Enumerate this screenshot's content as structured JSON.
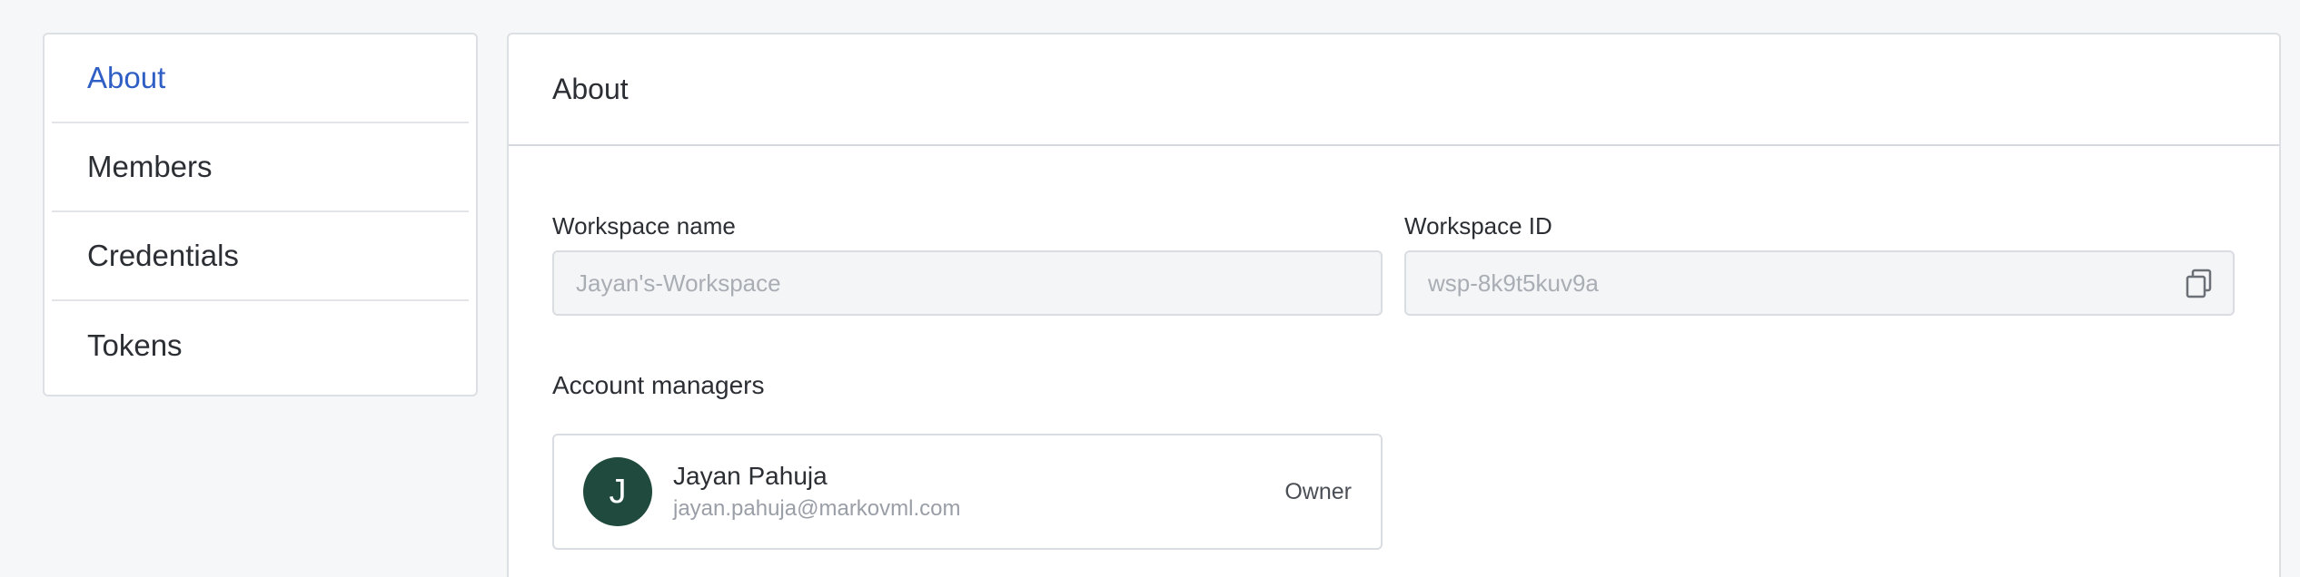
{
  "sidebar": {
    "items": [
      {
        "label": "About",
        "active": true
      },
      {
        "label": "Members",
        "active": false
      },
      {
        "label": "Credentials",
        "active": false
      },
      {
        "label": "Tokens",
        "active": false
      }
    ]
  },
  "main": {
    "title": "About",
    "workspace_name": {
      "label": "Workspace name",
      "value": "Jayan's-Workspace"
    },
    "workspace_id": {
      "label": "Workspace ID",
      "value": "wsp-8k9t5kuv9a",
      "copy_icon": "copy-icon"
    },
    "account_managers": {
      "label": "Account managers",
      "items": [
        {
          "initial": "J",
          "name": "Jayan Pahuja",
          "email": "jayan.pahuja@markovml.com",
          "role": "Owner"
        }
      ]
    }
  },
  "colors": {
    "accent": "#2f5ec4",
    "avatar_bg": "#1f4a3d",
    "page_bg": "#f6f7f9"
  }
}
